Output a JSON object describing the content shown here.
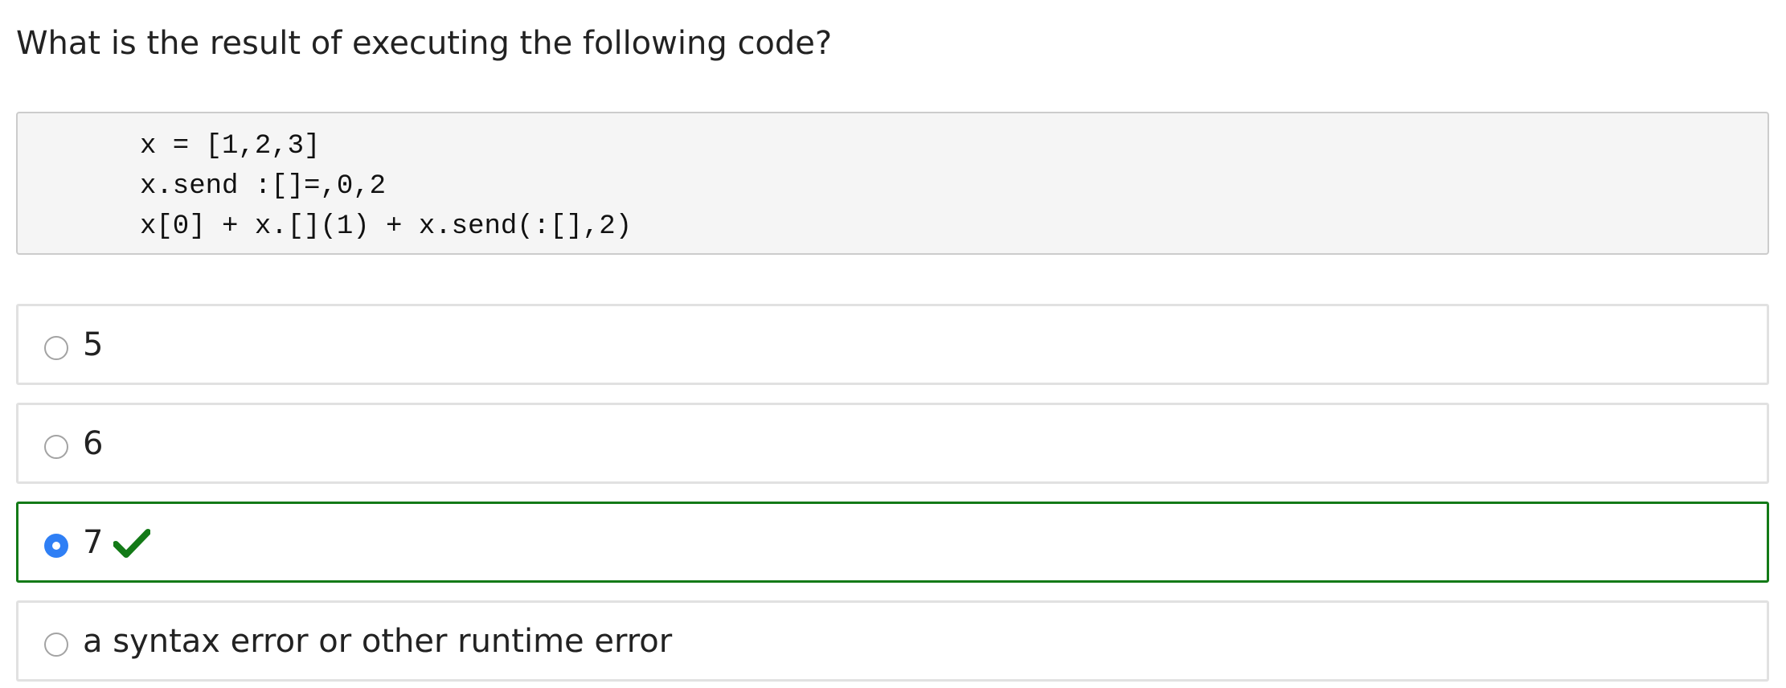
{
  "question": "What is the result of executing the following code?",
  "code": [
    "x = [1,2,3]",
    "x.send :[]=,0,2",
    "x[0] + x.[](1) + x.send(:[],2)"
  ],
  "options": [
    {
      "label": "5",
      "selected": false,
      "correct": false
    },
    {
      "label": "6",
      "selected": false,
      "correct": false
    },
    {
      "label": "7",
      "selected": true,
      "correct": true
    },
    {
      "label": "a syntax error or other runtime error",
      "selected": false,
      "correct": false
    }
  ],
  "icons": {
    "correct_marker": "checkmark-icon",
    "radio_unselected": "radio-unchecked-icon",
    "radio_selected": "radio-checked-icon"
  },
  "colors": {
    "correct": "#137a17",
    "selected_radio": "#2f7ff5",
    "option_border": "#e1e1e1",
    "code_background": "#f5f5f5"
  }
}
